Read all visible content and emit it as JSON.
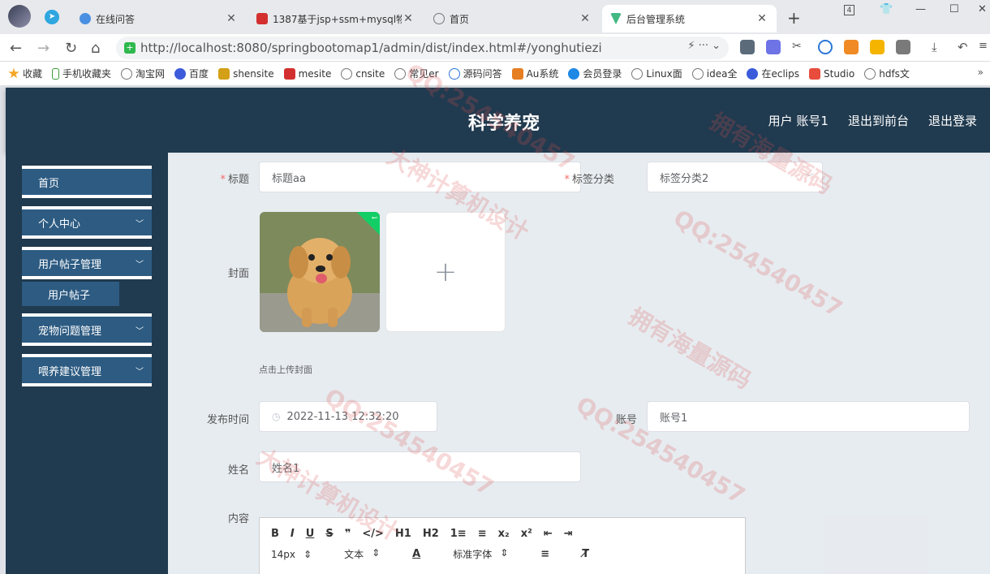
{
  "browser": {
    "tabs": [
      {
        "label": "在线问答",
        "icon_color": "#4a90e2"
      },
      {
        "label": "1387基于jsp+ssm+mysql物",
        "icon_color": "#d32f2f"
      },
      {
        "label": "首页",
        "icon_color": "#888888"
      },
      {
        "label": "后台管理系统",
        "icon_color": "#42b883"
      }
    ],
    "tab_badge": "4",
    "url": "http://localhost:8080/springbootomap1/admin/dist/index.html#/yonghutiezi",
    "url_actions": "⚡ ··· ⌄",
    "bookmarks": [
      "收藏",
      "手机收藏夹",
      "淘宝网",
      "百度",
      "shensite",
      "mesite",
      "cnsite",
      "常见er",
      "源码问答",
      "Au系统",
      "会员登录",
      "Linux面",
      "idea全",
      "在eclips",
      "Studio",
      "hdfs文"
    ]
  },
  "app": {
    "title": "科学养宠",
    "user_label": "用户 账号1",
    "frontend_link": "退出到前台",
    "logout_link": "退出登录"
  },
  "sidebar": {
    "items": [
      {
        "label": "首页",
        "has_chevron": false
      },
      {
        "label": "个人中心",
        "has_chevron": true
      },
      {
        "label": "用户帖子管理",
        "has_chevron": true
      },
      {
        "label": "宠物问题管理",
        "has_chevron": true
      },
      {
        "label": "喂养建议管理",
        "has_chevron": true
      }
    ],
    "subitem": "用户帖子"
  },
  "form": {
    "title_label": "标题",
    "title_value": "标题aa",
    "tag_label": "标签分类",
    "tag_value": "标签分类2",
    "cover_label": "封面",
    "cover_tip": "点击上传封面",
    "publish_label": "发布时间",
    "publish_value": "2022-11-13 12:32:20",
    "account_label": "账号",
    "account_value": "账号1",
    "name_label": "姓名",
    "name_value": "姓名1",
    "content_label": "内容",
    "editor": {
      "row1": [
        "B",
        "I",
        "U",
        "S",
        "❞",
        "</>",
        "H1",
        "H2",
        "1≡",
        "≡",
        "x₂",
        "x²",
        "⇤",
        "⇥"
      ],
      "font_size": "14px",
      "text_type": "文本",
      "font_family": "标准字体"
    }
  },
  "watermark": {
    "texts": [
      "QQ:254540457",
      "拥有海量源码",
      "大神计算机设计"
    ]
  }
}
